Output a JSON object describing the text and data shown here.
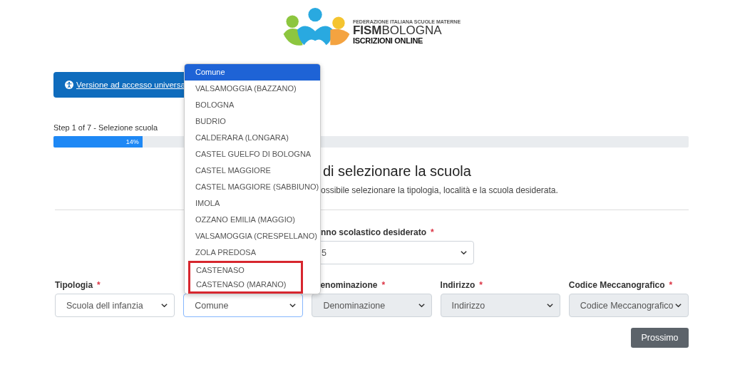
{
  "logo": {
    "small": "FEDERAZIONE ITALIANA SCUOLE MATERNE",
    "brand_a": "FISM",
    "brand_b": "BOLOGNA",
    "tagline": "ISCRIZIONI ONLINE"
  },
  "accessibility_link": "Versione ad accesso universa",
  "progress": {
    "label": "Step 1 of 7 - Selezione scuola",
    "level": 0.14,
    "reading": "14%"
  },
  "heading": "di selezionare la scuola",
  "subtitle": "ossibile selezionare la tipologia, località e la scuola desiderata.",
  "year_field": {
    "label": "nno scolastico desiderato",
    "mark": "*",
    "value": "5"
  },
  "fields": [
    {
      "label": "Tipologia",
      "mark": "*",
      "value": "Scuola dell infanzia",
      "disabled": false,
      "focused": false
    },
    {
      "value": "Comune",
      "disabled": false,
      "focused": true
    },
    {
      "label": "enominazione",
      "mark": "*",
      "value": "Denominazione",
      "disabled": true,
      "focused": false
    },
    {
      "label": "Indirizzo",
      "mark": "*",
      "value": "Indirizzo",
      "disabled": true,
      "focused": false
    },
    {
      "label": "Codice Meccanografico",
      "mark": "*",
      "value": "Codice Meccanografico",
      "disabled": true,
      "focused": false
    }
  ],
  "dropdown": {
    "options": [
      {
        "label": "Comune",
        "selected": true,
        "highlighted": false
      },
      {
        "label": "VALSAMOGGIA (BAZZANO)",
        "selected": false,
        "highlighted": false
      },
      {
        "label": "BOLOGNA",
        "selected": false,
        "highlighted": false
      },
      {
        "label": "BUDRIO",
        "selected": false,
        "highlighted": false
      },
      {
        "label": "CALDERARA (LONGARA)",
        "selected": false,
        "highlighted": false
      },
      {
        "label": "CASTEL GUELFO DI BOLOGNA",
        "selected": false,
        "highlighted": false
      },
      {
        "label": "CASTEL MAGGIORE",
        "selected": false,
        "highlighted": false
      },
      {
        "label": "CASTEL MAGGIORE (SABBIUNO)",
        "selected": false,
        "highlighted": false
      },
      {
        "label": "IMOLA",
        "selected": false,
        "highlighted": false
      },
      {
        "label": "OZZANO EMILIA (MAGGIO)",
        "selected": false,
        "highlighted": false
      },
      {
        "label": "VALSAMOGGIA (CRESPELLANO)",
        "selected": false,
        "highlighted": false
      },
      {
        "label": "ZOLA PREDOSA",
        "selected": false,
        "highlighted": false
      },
      {
        "label": "CASTENASO",
        "selected": false,
        "highlighted": true
      },
      {
        "label": "CASTENASO (MARANO)",
        "selected": false,
        "highlighted": true
      }
    ]
  },
  "next_button": "Prossimo"
}
